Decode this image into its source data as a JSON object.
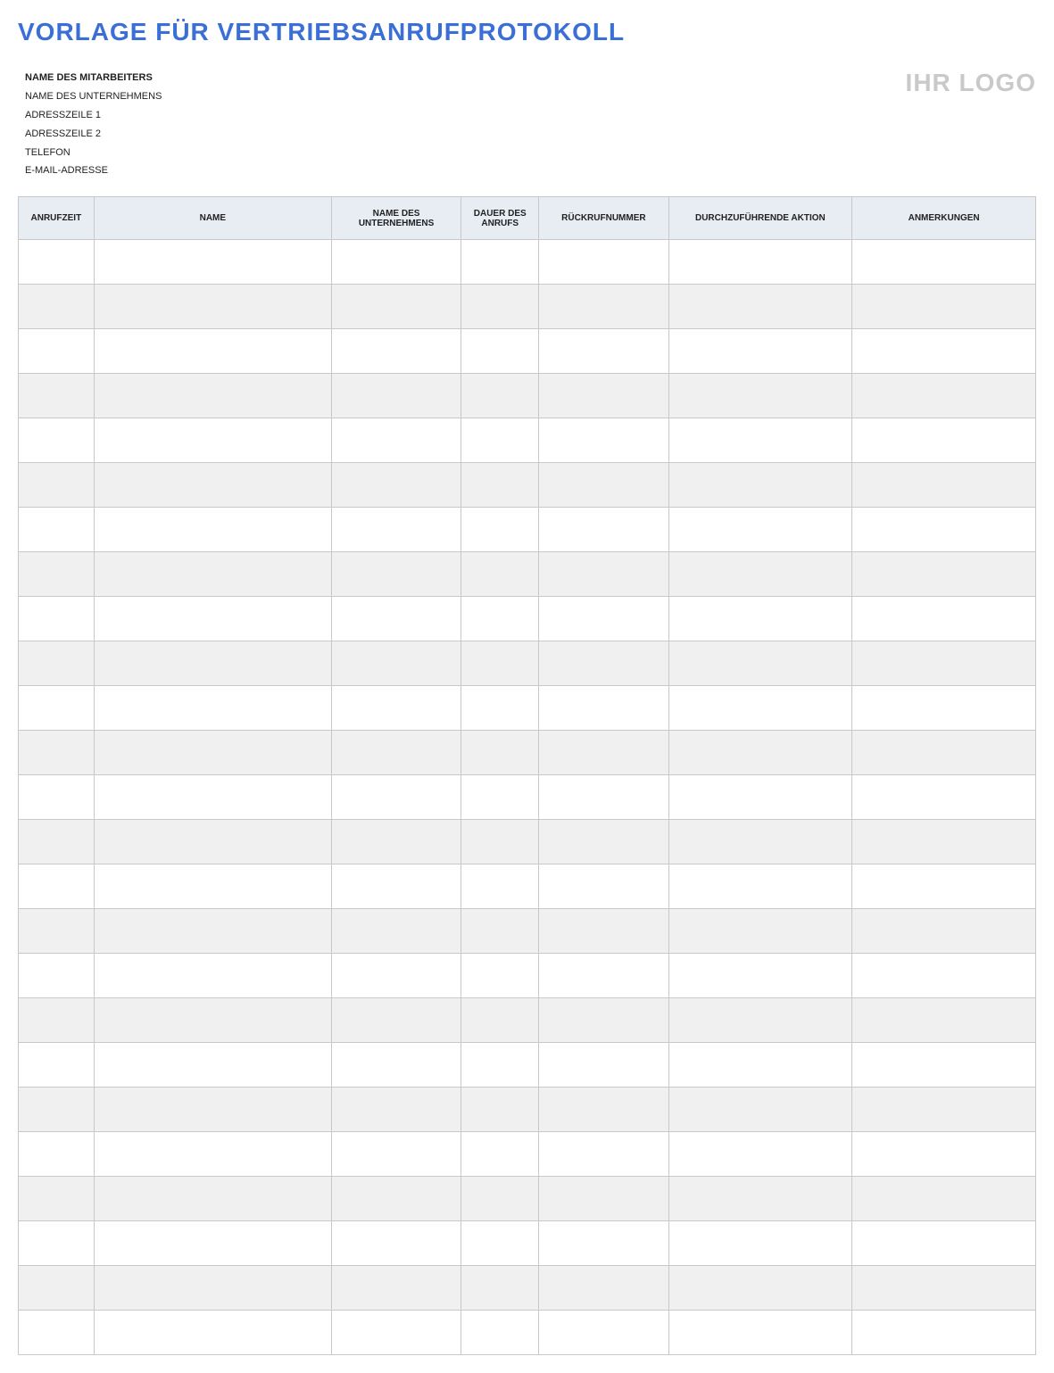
{
  "title": "VORLAGE FÜR VERTRIEBSANRUFPROTOKOLL",
  "logo_text": "IHR LOGO",
  "info": {
    "employee_label": "NAME DES MITARBEITERS",
    "company_label": "NAME DES UNTERNEHMENS",
    "address1_label": "ADRESSZEILE 1",
    "address2_label": "ADRESSZEILE 2",
    "phone_label": "TELEFON",
    "email_label": "E-MAIL-ADRESSE"
  },
  "columns": {
    "time": "ANRUFZEIT",
    "name": "NAME",
    "company": "NAME DES UNTERNEHMENS",
    "duration": "DAUER DES ANRUFS",
    "callback": "RÜCKRUFNUMMER",
    "action": "DURCHZUFÜHRENDE AKTION",
    "notes": "ANMERKUNGEN"
  },
  "row_count": 25
}
